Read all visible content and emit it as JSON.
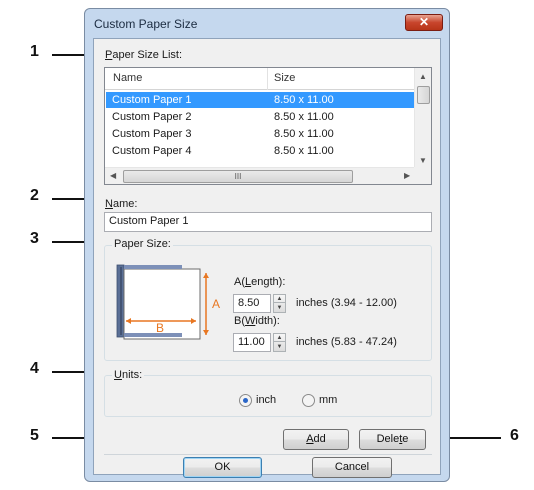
{
  "callouts": [
    "1",
    "2",
    "3",
    "4",
    "5",
    "6"
  ],
  "dialog": {
    "title": "Custom Paper Size",
    "close_glyph": "✕"
  },
  "paper_size_list": {
    "label_ul": "P",
    "label_rest": "aper Size List:",
    "columns": [
      "Name",
      "Size"
    ],
    "rows": [
      {
        "name": "Custom Paper 1",
        "size": "8.50 x 11.00",
        "selected": true
      },
      {
        "name": "Custom Paper 2",
        "size": "8.50 x 11.00",
        "selected": false
      },
      {
        "name": "Custom Paper 3",
        "size": "8.50 x 11.00",
        "selected": false
      },
      {
        "name": "Custom Paper 4",
        "size": "8.50 x 11.00",
        "selected": false
      }
    ],
    "hscroll_grip": "III"
  },
  "name_field": {
    "label_ul": "N",
    "label_rest": "ame:",
    "value": "Custom Paper 1"
  },
  "paper_size": {
    "group_label": "Paper Size:",
    "diagram": {
      "letter_a": "A",
      "letter_b": "B",
      "arrow_color": "#e87722"
    },
    "length": {
      "label_pre": "A(",
      "label_ul": "L",
      "label_post": "ength):",
      "value": "8.50",
      "range": "inches (3.94 - 12.00)"
    },
    "width": {
      "label_pre": "B(",
      "label_ul": "W",
      "label_post": "idth):",
      "value": "11.00",
      "range": "inches (5.83 - 47.24)"
    }
  },
  "units": {
    "label_ul": "U",
    "label_rest": "nits:",
    "options": [
      {
        "label": "inch",
        "checked": true
      },
      {
        "label": "mm",
        "checked": false
      }
    ]
  },
  "buttons": {
    "add_ul": "A",
    "add_rest": "dd",
    "delete_pre": "Dele",
    "delete_ul": "t",
    "delete_post": "e",
    "ok": "OK",
    "cancel": "Cancel"
  }
}
